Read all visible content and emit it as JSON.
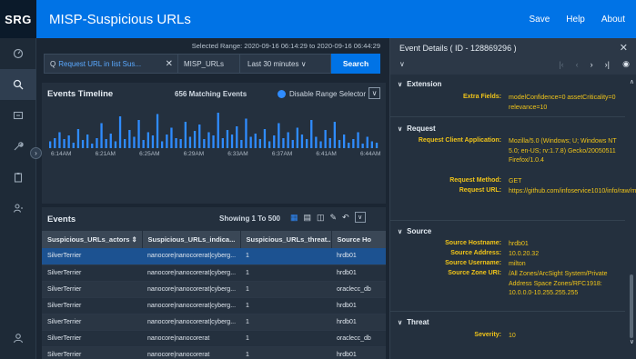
{
  "app": {
    "logo": "SRG",
    "title": "MISP-Suspicious URLs",
    "links": [
      "Save",
      "Help",
      "About"
    ]
  },
  "rail": {
    "icons": [
      "dashboard-icon",
      "search-icon",
      "channels-icon",
      "tools-icon",
      "clipboard-icon",
      "user-group-icon"
    ],
    "bottom_icon": "user-icon"
  },
  "search": {
    "range_label": "Selected Range: 2020-09-16 06:14:29  to  2020-09-16 06:44:29",
    "query_prefix": "Q",
    "query_text": "Request URL in list Sus...",
    "resource": "MISP_URLs",
    "time_option": "Last 30 minutes ∨",
    "button": "Search"
  },
  "timeline": {
    "title": "Events Timeline",
    "count": "656 Matching Events",
    "toggle_label": "Disable Range Selector",
    "ticks": [
      "6:14AM",
      "6:21AM",
      "6:25AM",
      "6:29AM",
      "6:33AM",
      "6:37AM",
      "6:41AM",
      "6:44AM"
    ],
    "bar_levels": [
      0.15,
      0.22,
      0.35,
      0.2,
      0.28,
      0.12,
      0.42,
      0.18,
      0.3,
      0.1,
      0.22,
      0.55,
      0.2,
      0.32,
      0.15,
      0.7,
      0.2,
      0.4,
      0.25,
      0.62,
      0.18,
      0.35,
      0.28,
      0.75,
      0.15,
      0.3,
      0.45,
      0.22,
      0.2,
      0.58,
      0.25,
      0.38,
      0.52,
      0.2,
      0.35,
      0.28,
      0.78,
      0.22,
      0.4,
      0.3,
      0.48,
      0.18,
      0.65,
      0.25,
      0.32,
      0.2,
      0.42,
      0.15,
      0.28,
      0.55,
      0.22,
      0.35,
      0.18,
      0.45,
      0.3,
      0.2,
      0.62,
      0.25,
      0.15,
      0.4,
      0.22,
      0.58,
      0.18,
      0.3,
      0.12,
      0.2,
      0.35,
      0.1,
      0.25,
      0.15,
      0.12
    ]
  },
  "events": {
    "title": "Events",
    "showing": "Showing 1 To 500",
    "columns": [
      "Suspicious_URLs_actors ⇕",
      "Suspicious_URLs_indica...",
      "Suspicious_URLs_threat...",
      "Source Ho"
    ],
    "rows": [
      [
        "SilverTerrier",
        "nanocore|nanocorerat|cyberg...",
        "1",
        "hrdb01"
      ],
      [
        "SilverTerrier",
        "nanocore|nanocorerat|cyberg...",
        "1",
        "hrdb01"
      ],
      [
        "SilverTerrier",
        "nanocore|nanocorerat|cyberg...",
        "1",
        "oraclecc_db"
      ],
      [
        "SilverTerrier",
        "nanocore|nanocorerat|cyberg...",
        "1",
        "hrdb01"
      ],
      [
        "SilverTerrier",
        "nanocore|nanocorerat|cyberg...",
        "1",
        "hrdb01"
      ],
      [
        "SilverTerrier",
        "nanocore|nanocorerat",
        "1",
        "oraclecc_db"
      ],
      [
        "SilverTerrier",
        "nanocore|nanocorerat",
        "1",
        "hrdb01"
      ]
    ]
  },
  "details": {
    "title": "Event Details ( ID - 128869296 )",
    "sections": {
      "extension": {
        "name": "Extension",
        "fields": [
          {
            "k": "Extra Fields:",
            "v": "modelConfidence=0 assetCriticality=0 relevance=10"
          }
        ]
      },
      "request": {
        "name": "Request",
        "fields": [
          {
            "k": "Request Client Application:",
            "v": "Mozilla/5.0 (Windows; U; Windows NT 5.0; en-US; rv:1.7.8) Gecko/20050511 Firefox/1.0.4"
          },
          {
            "k": "Request Method:",
            "v": "GET"
          },
          {
            "k": "Request URL:",
            "v": "https://github.com/infoservice1010/info/raw/master/lundi.exe"
          }
        ]
      },
      "source": {
        "name": "Source",
        "fields": [
          {
            "k": "Source Hostname:",
            "v": "hrdb01"
          },
          {
            "k": "Source Address:",
            "v": "10.0.20.32"
          },
          {
            "k": "Source Username:",
            "v": "milton"
          },
          {
            "k": "Source Zone URI:",
            "v": "/All Zones/ArcSight System/Private Address Space Zones/RFC1918: 10.0.0.0-10.255.255.255"
          }
        ]
      },
      "threat": {
        "name": "Threat",
        "fields": [
          {
            "k": "Severity:",
            "v": "10"
          }
        ]
      }
    }
  },
  "colors": {
    "accent": "#0073e6",
    "value_yellow": "#f0c419",
    "selected_row": "#1c5291"
  }
}
